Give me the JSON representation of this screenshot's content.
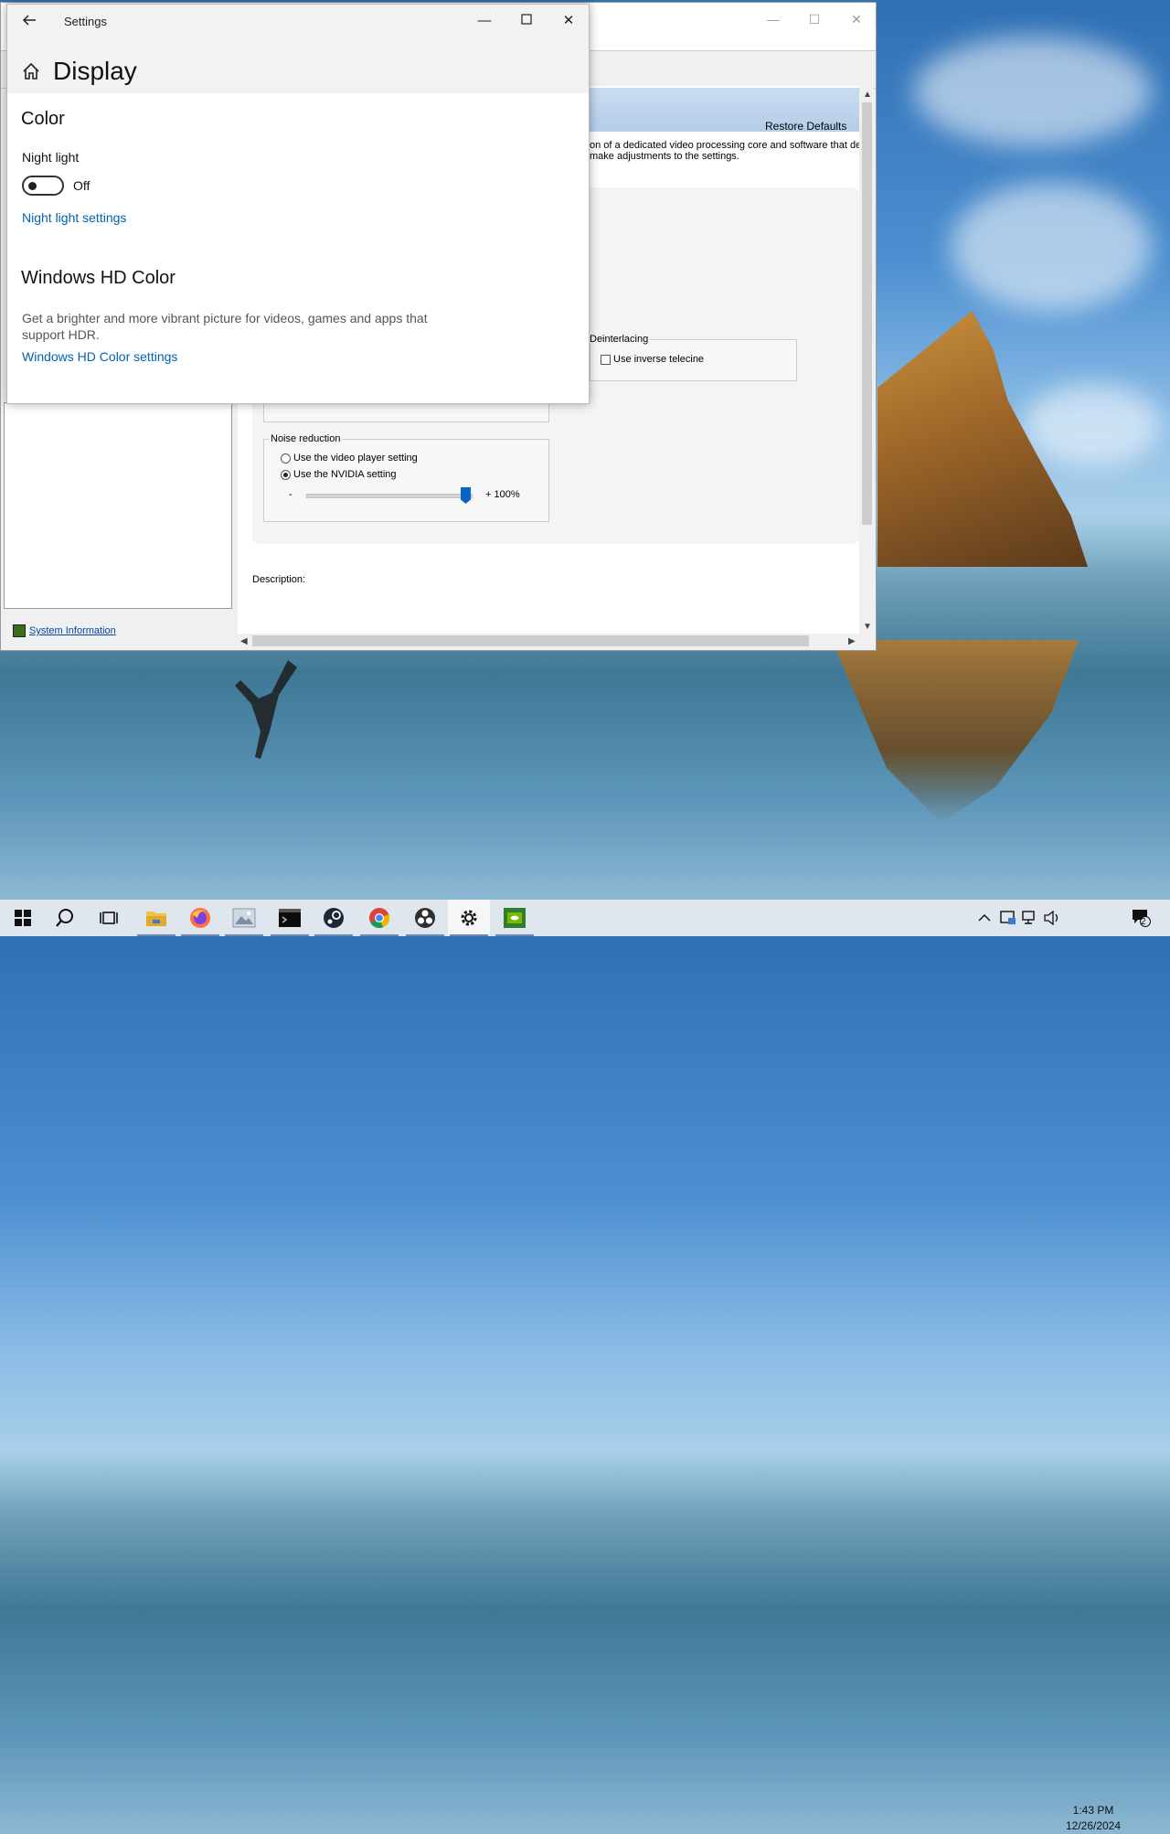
{
  "nvidia": {
    "restore_defaults": "Restore Defaults",
    "intro_line1": "on of a dedicated video processing core and software that deliv",
    "intro_line2": "make adjustments to the settings.",
    "deinterlacing_label": "Deinterlacing",
    "inverse_telecine_label": "Use inverse telecine",
    "inverse_telecine_checked": false,
    "noise_reduction_label": "Noise reduction",
    "radio_video_player": "Use the video player setting",
    "radio_nvidia": "Use the NVIDIA setting",
    "selected_radio": "nvidia",
    "slider_minus": "-",
    "slider_plus": "+",
    "slider_value_text": "100%",
    "slider_value": 1.0,
    "description_label": "Description:",
    "system_information": "System Information"
  },
  "settings": {
    "window_title": "Settings",
    "page_title": "Display",
    "color_section": "Color",
    "night_light_label": "Night light",
    "night_light_state": "Off",
    "night_light_settings_link": "Night light settings",
    "hd_color_section": "Windows HD Color",
    "hd_color_description": "Get a brighter and more vibrant picture for videos, games and apps that support HDR.",
    "hd_color_settings_link": "Windows HD Color settings"
  },
  "taskbar": {
    "items": [
      {
        "name": "start-button",
        "icon": "windows-logo-icon"
      },
      {
        "name": "search-button",
        "icon": "search-icon"
      },
      {
        "name": "task-view-button",
        "icon": "task-view-icon"
      },
      {
        "name": "file-explorer",
        "icon": "folder-icon"
      },
      {
        "name": "firefox",
        "icon": "firefox-icon"
      },
      {
        "name": "photos",
        "icon": "photos-icon"
      },
      {
        "name": "terminal",
        "icon": "terminal-icon"
      },
      {
        "name": "steam",
        "icon": "steam-icon"
      },
      {
        "name": "chrome",
        "icon": "chrome-icon"
      },
      {
        "name": "obs",
        "icon": "obs-icon"
      },
      {
        "name": "settings",
        "icon": "gear-icon"
      },
      {
        "name": "nvidia-control-panel",
        "icon": "nvidia-icon"
      }
    ],
    "time": "1:43 PM",
    "date": "12/26/2024",
    "notification_count": "2"
  },
  "colors": {
    "accent_link": "#0063b1",
    "nvidia_slider": "#0a64c8",
    "nvidia_link": "#0645ad"
  }
}
